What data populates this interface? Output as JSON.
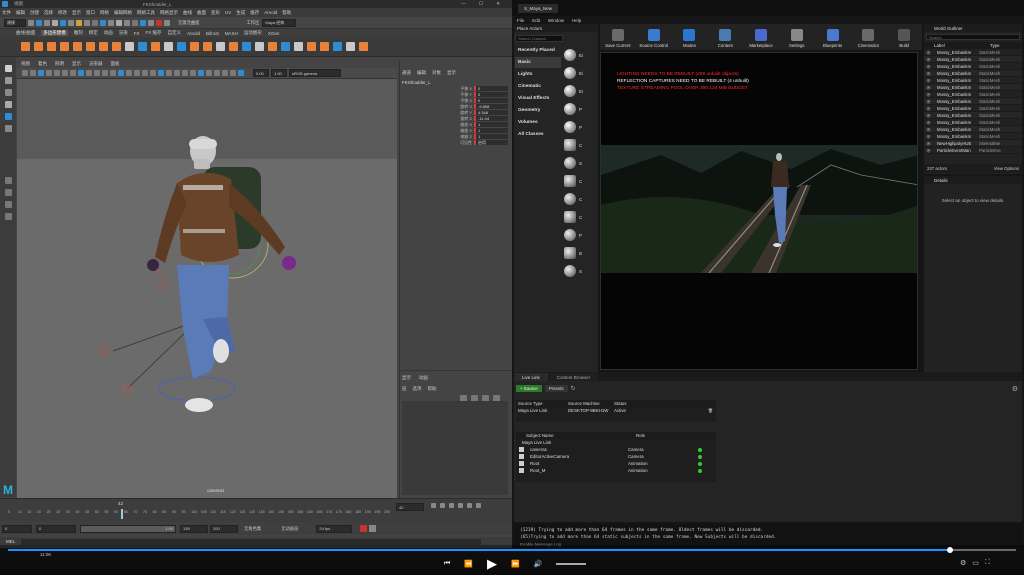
{
  "maya": {
    "title_short": "视图",
    "title_file": "FKShoulder_L",
    "menu": [
      "文件",
      "编辑",
      "创建",
      "选择",
      "修改",
      "显示",
      "窗口",
      "网格",
      "编辑网格",
      "网格工具",
      "网格显示",
      "曲线",
      "曲面",
      "变形",
      "UV",
      "生成",
      "缓存",
      "Arnold",
      "帮助"
    ],
    "workspace_label": "工作区",
    "workspace_value": "Maya 经典",
    "mode_dropdown": "建模",
    "live_text": "无激活曲面",
    "shelf_tabs": [
      "曲线/曲面",
      "多边形建模",
      "雕刻",
      "绑定",
      "动画",
      "渲染",
      "FX",
      "FX 缓存",
      "自定义",
      "Arnold",
      "Bifrost",
      "MASH",
      "运动图形",
      "XGen"
    ],
    "viewport_menu": [
      "视图",
      "着色",
      "照明",
      "显示",
      "渲染器",
      "面板"
    ],
    "viewport_values": {
      "exposure": "0.00",
      "gamma": "1.00",
      "color_space": "sRGB gamma"
    },
    "camera_label": "camera1",
    "channel_tabs": [
      "通道",
      "编辑",
      "对象",
      "显示"
    ],
    "channel_node": "FKShoulder_L",
    "attributes": [
      {
        "label": "平移 X",
        "value": "0"
      },
      {
        "label": "平移 Y",
        "value": "0"
      },
      {
        "label": "平移 Z",
        "value": "0"
      },
      {
        "label": "旋转 X",
        "value": "-9.858"
      },
      {
        "label": "旋转 Y",
        "value": "4.548"
      },
      {
        "label": "旋转 Z",
        "value": "-11.04"
      },
      {
        "label": "缩放 X",
        "value": "1"
      },
      {
        "label": "缩放 Y",
        "value": "1"
      },
      {
        "label": "缩放 Z",
        "value": "1"
      },
      {
        "label": "可见性",
        "value": "启用"
      }
    ],
    "layer_tabs": [
      "显示",
      "动画"
    ],
    "layer_menu": [
      "层",
      "选项",
      "帮助"
    ],
    "timeline_ticks": [
      "5",
      "10",
      "15",
      "20",
      "25",
      "30",
      "35",
      "40",
      "45",
      "50",
      "55",
      "60",
      "65",
      "70",
      "75",
      "80",
      "85",
      "90",
      "95",
      "100",
      "105",
      "110",
      "115",
      "120",
      "125",
      "130",
      "135",
      "140",
      "145",
      "150",
      "155",
      "160",
      "165",
      "170",
      "175",
      "180",
      "185",
      "190",
      "195",
      "200"
    ],
    "current_frame_marker": "42",
    "current_frame": "42",
    "range": {
      "start": "0",
      "anim_start": "0",
      "range_start": "1.00",
      "range_end": "139",
      "anim_end": "200",
      "no_char": "无角色集",
      "no_layer": "无动画层",
      "fps": "24 fps"
    },
    "mel_label": "MEL"
  },
  "ue": {
    "tab_title": "S_Maya_New",
    "menu": [
      "File",
      "Edit",
      "Window",
      "Help"
    ],
    "place_actors": {
      "title": "Place Actors",
      "search_placeholder": "Search Classes",
      "categories": [
        "Recently Placed",
        "Basic",
        "Lights",
        "Cinematic",
        "Visual Effects",
        "Geometry",
        "Volumes",
        "All Classes"
      ],
      "items": [
        "Ei",
        "Ei",
        "Ei",
        "P",
        "P",
        "C",
        "S",
        "C",
        "C",
        "C",
        "P",
        "B",
        "S"
      ]
    },
    "toolbar": [
      "Save Current",
      "Source Control",
      "Modes",
      "Content",
      "Marketplace",
      "Settings",
      "Blueprints",
      "Cinematics",
      "Build"
    ],
    "viewport_messages": [
      {
        "text": "LIGHTING NEEDS TO BE REBUILT (289 unbuilt objects)",
        "color": "#ff2a2a"
      },
      {
        "text": "REFLECTION CAPTURES NEED TO BE REBUILT (4 unbuilt)",
        "color": "#ffffff"
      },
      {
        "text": "TEXTURE STREAMING POOL OVER 390.134 MiB BUDGET",
        "color": "#ff2a2a"
      }
    ],
    "outliner": {
      "title": "World Outliner",
      "search_placeholder": "Search",
      "col_label": "Label",
      "col_type": "Type",
      "rows": [
        {
          "name": "Mossy_Embankm",
          "type": "StaticMesh"
        },
        {
          "name": "Mossy_Embankm",
          "type": "StaticMesh"
        },
        {
          "name": "Mossy_Embankm",
          "type": "StaticMesh"
        },
        {
          "name": "Mossy_Embankm",
          "type": "StaticMesh"
        },
        {
          "name": "Mossy_Embankm",
          "type": "StaticMesh"
        },
        {
          "name": "Mossy_Embankm",
          "type": "StaticMesh"
        },
        {
          "name": "Mossy_Embankm",
          "type": "StaticMesh"
        },
        {
          "name": "Mossy_Embankm",
          "type": "StaticMesh"
        },
        {
          "name": "Mossy_Embankm",
          "type": "StaticMesh"
        },
        {
          "name": "Mossy_Embankm",
          "type": "StaticMesh"
        },
        {
          "name": "Mossy_Embankm",
          "type": "StaticMesh"
        },
        {
          "name": "Mossy_Embankm",
          "type": "StaticMesh"
        },
        {
          "name": "Mossy_Embankm",
          "type": "StaticMesh"
        },
        {
          "name": "NewHighpolyHUE",
          "type": "SkeletalMe"
        },
        {
          "name": "ParticleEventMan",
          "type": "ParticleEve"
        }
      ],
      "actor_count": "237 actors",
      "view_options": "View Options"
    },
    "details": {
      "title": "Details",
      "empty_msg": "Select an object to view details."
    },
    "live_link": {
      "tabs": [
        "Live Link",
        "Content Browser"
      ],
      "add_source": "+ Source",
      "presets": "Presets",
      "source_headers": [
        "Source Type",
        "Source Machine",
        "Status"
      ],
      "source_row": [
        "Maya Live Link",
        "DESKTOP-9BKH1W",
        "Active"
      ],
      "subject_headers": [
        "Subject Name",
        "Role"
      ],
      "subject_group": "Maya Live Link",
      "subjects": [
        {
          "name": "camera1",
          "role": "Camera"
        },
        {
          "name": "EditorActiveCamera",
          "role": "Camera"
        },
        {
          "name": "Root",
          "role": "Animation"
        },
        {
          "name": "Root_M",
          "role": "Animation"
        }
      ]
    },
    "log_lines": [
      "(1219) Trying to add more than 64 frames in the same frame. Oldest frames will be discarded.",
      "(65)Trying to add more than 64 static subjects in the same frame. New Subjects will be discarded."
    ],
    "log_footer": "Enable Message Log"
  },
  "player": {
    "progress": 0.935,
    "time_left": "11:06"
  },
  "colors": {
    "maya_accent": "#2f8cd3",
    "ue_red": "#ff2a2a",
    "seek_blue": "#1e90ff",
    "live_green": "#2bd12b",
    "attr_red": "#d7383f"
  }
}
